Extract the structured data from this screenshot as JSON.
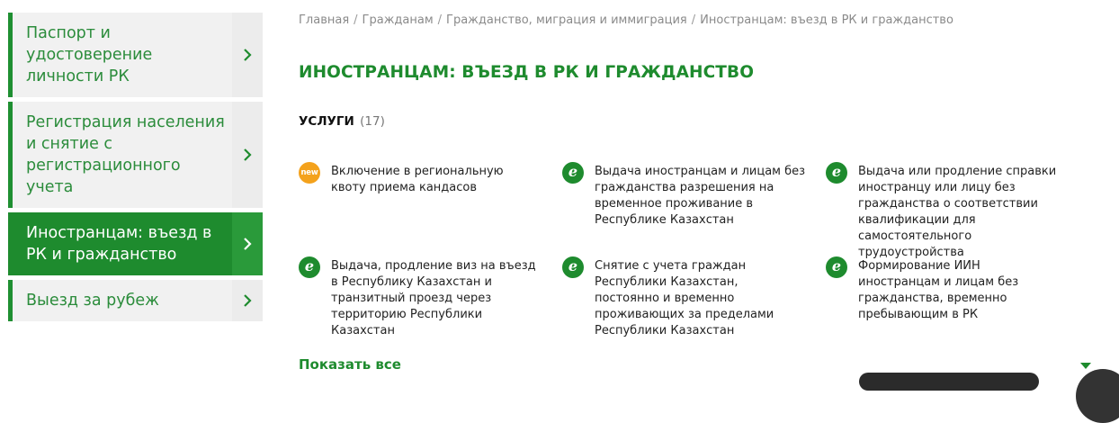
{
  "sidebar": {
    "items": [
      {
        "label": "Паспорт и удостоверение личности РК",
        "active": false
      },
      {
        "label": "Регистрация населения и снятие с регистрационного учета",
        "active": false
      },
      {
        "label": "Иностранцам: въезд в РК и гражданство",
        "active": true
      },
      {
        "label": "Выезд за рубеж",
        "active": false
      }
    ]
  },
  "breadcrumb": {
    "items": [
      "Главная",
      "Гражданам",
      "Гражданство, миграция и иммиграция",
      "Иностранцам: въезд в РК и гражданство"
    ],
    "separator": "/"
  },
  "main": {
    "title": "ИНОСТРАНЦАМ: ВЪЕЗД В РК И ГРАЖДАНСТВО",
    "services_title": "УСЛУГИ",
    "services_count": "(17)",
    "services": [
      {
        "badge": "new",
        "icon": "new-badge-icon",
        "text": "Включение в региональную квоту приема кандасов"
      },
      {
        "badge": "e",
        "icon": "e-service-icon",
        "text": "Выдача иностранцам и лицам без гражданства разрешения на временное проживание в Республике Казахстан"
      },
      {
        "badge": "e",
        "icon": "e-service-icon",
        "text": "Выдача или продление справки иностранцу или лицу без гражданства о соответствии квалификации для самостоятельного трудоустройства"
      },
      {
        "badge": "e",
        "icon": "e-service-icon",
        "text": "Выдача, продление виз на въезд в Республику Казахстан и транзитный проезд через территорию Республики Казахстан"
      },
      {
        "badge": "e",
        "icon": "e-service-icon",
        "text": "Снятие с учета граждан Республики Казахстан, постоянно и временно проживающих за пределами Республики Казахстан"
      },
      {
        "badge": "e",
        "icon": "e-service-icon",
        "text": "Формирование ИИН иностранцам и лицам без гражданства, временно пребывающим в РК"
      }
    ],
    "show_all": "Показать все"
  },
  "colors": {
    "accent": "#1e8b2e",
    "new_badge": "#f4a21c",
    "sidebar_bg": "#f1f1f1"
  }
}
